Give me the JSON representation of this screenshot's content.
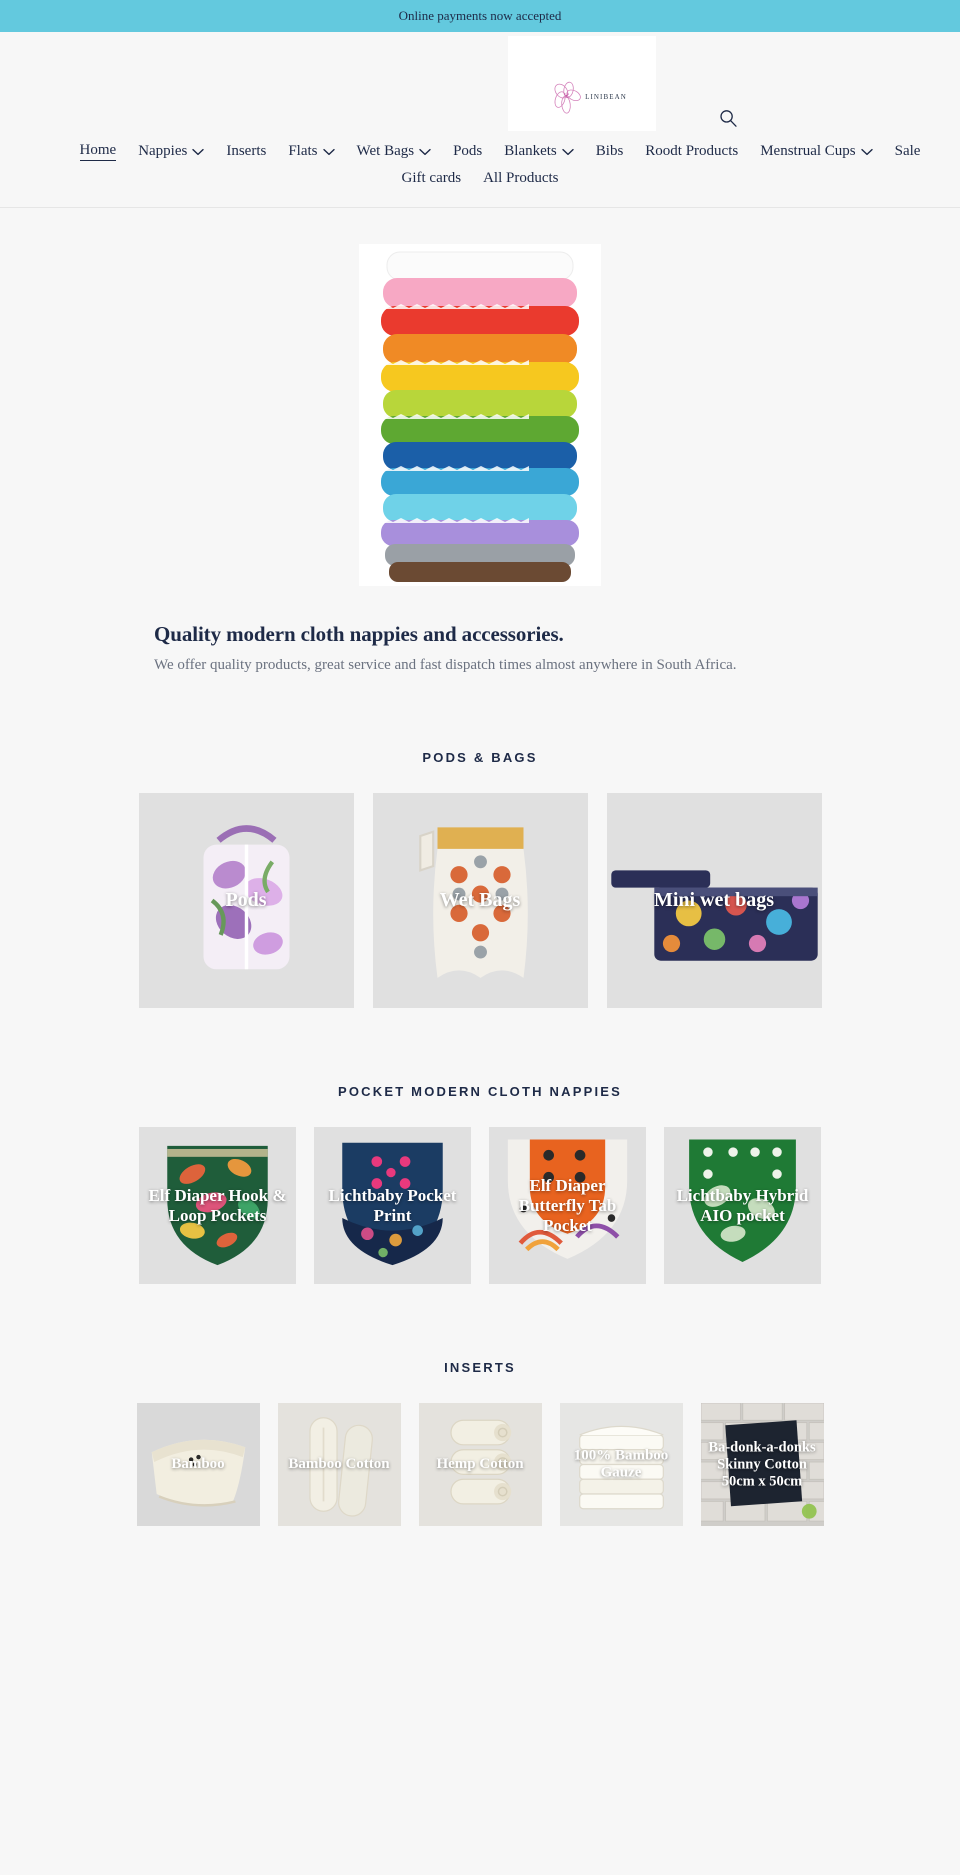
{
  "announcement": {
    "text": "Online payments now accepted"
  },
  "header": {
    "logo_word": "LINIBEAN",
    "search_icon": "search-icon"
  },
  "nav": {
    "row1": [
      {
        "label": "Home",
        "active": true,
        "dropdown": false
      },
      {
        "label": "Nappies",
        "active": false,
        "dropdown": true
      },
      {
        "label": "Inserts",
        "active": false,
        "dropdown": false
      },
      {
        "label": "Flats",
        "active": false,
        "dropdown": true
      },
      {
        "label": "Wet Bags",
        "active": false,
        "dropdown": true
      },
      {
        "label": "Pods",
        "active": false,
        "dropdown": false
      },
      {
        "label": "Blankets",
        "active": false,
        "dropdown": true
      },
      {
        "label": "Bibs",
        "active": false,
        "dropdown": false
      },
      {
        "label": "Roodt Products",
        "active": false,
        "dropdown": false
      },
      {
        "label": "Menstrual Cups",
        "active": false,
        "dropdown": true
      },
      {
        "label": "Sale",
        "active": false,
        "dropdown": false
      }
    ],
    "row2": [
      {
        "label": "Gift cards",
        "active": false,
        "dropdown": false
      },
      {
        "label": "All Products",
        "active": false,
        "dropdown": false
      }
    ]
  },
  "hero": {
    "image_alt": "stack-of-colorful-cloth-nappies",
    "title": "Quality modern cloth nappies and accessories.",
    "subtitle": "We offer quality products, great service and fast dispatch times almost anywhere in South Africa."
  },
  "sections": [
    {
      "title": "PODS & BAGS",
      "cards": [
        {
          "label": "Pods",
          "image": "floral-pod-bag"
        },
        {
          "label": "Wet Bags",
          "image": "animal-print-wet-bag"
        },
        {
          "label": "Mini wet bags",
          "image": "colorful-mini-wet-bag"
        }
      ]
    },
    {
      "title": "POCKET MODERN CLOTH NAPPIES",
      "cards": [
        {
          "label": "Elf Diaper Hook & Loop Pockets",
          "image": "tropical-print-nappy"
        },
        {
          "label": "Lichtbaby Pocket Print",
          "image": "navy-floral-nappy"
        },
        {
          "label": "Elf Diaper Butterfly Tab Pocket",
          "image": "orange-rainbow-nappy"
        },
        {
          "label": "Lichtbaby Hybrid AIO pocket",
          "image": "green-leaf-nappy"
        }
      ]
    },
    {
      "title": "INSERTS",
      "cards": [
        {
          "label": "Bamboo",
          "image": "bamboo-insert-folded"
        },
        {
          "label": "Bamboo Cotton",
          "image": "bamboo-cotton-inserts"
        },
        {
          "label": "Hemp Cotton",
          "image": "hemp-cotton-rolled-inserts"
        },
        {
          "label": "100% Bamboo Gauze",
          "image": "bamboo-gauze-stack"
        },
        {
          "label": "Ba-donk-a-donks Skinny Cotton 50cm x 50cm",
          "image": "badonk-skinny-cotton"
        }
      ]
    }
  ],
  "colors": {
    "announcement_bg": "#63c9de",
    "page_bg": "#f7f7f7",
    "text_dark": "#1e2a47",
    "card_bg": "#e0e0e0",
    "logo_pink": "#d96bb0"
  }
}
